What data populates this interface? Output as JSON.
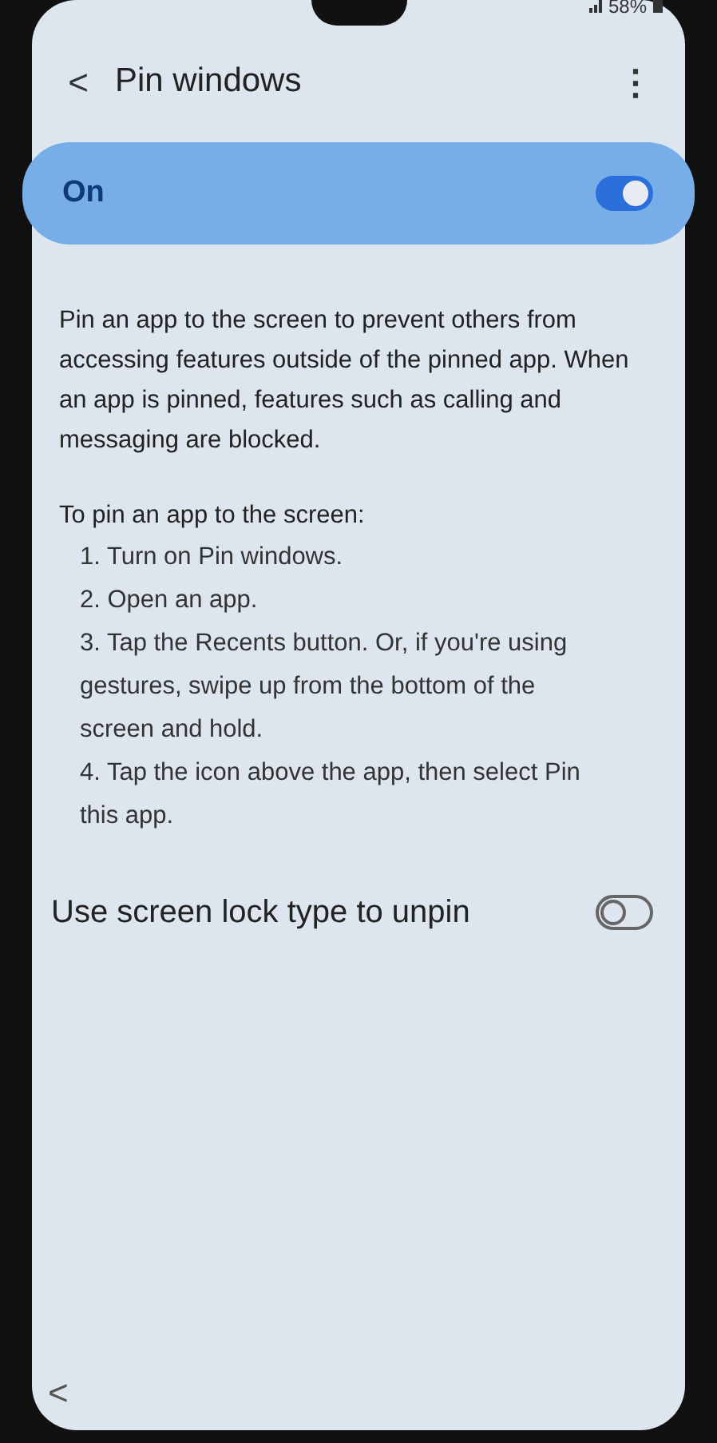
{
  "status_bar": {
    "battery": "58%"
  },
  "header": {
    "back": "<",
    "title": "Pin windows",
    "menu": "⋮"
  },
  "master_switch": {
    "label": "On",
    "on": true
  },
  "description": "Pin an app to the screen to prevent others from accessing features outside of the pinned app. When an app is pinned, features such as calling and messaging are blocked.",
  "instructions": {
    "heading": "To pin an app to the screen:",
    "steps": [
      "1. Turn on Pin windows.",
      "2. Open an app.",
      "3. Tap the Recents button. Or, if you're using gestures, swipe up from the bottom of the screen and hold.",
      "4. Tap the icon above the app, then select Pin this app."
    ]
  },
  "settings": [
    {
      "label": "Use screen lock type to unpin",
      "on": false
    }
  ],
  "nav_bar": {
    "back": "<"
  }
}
